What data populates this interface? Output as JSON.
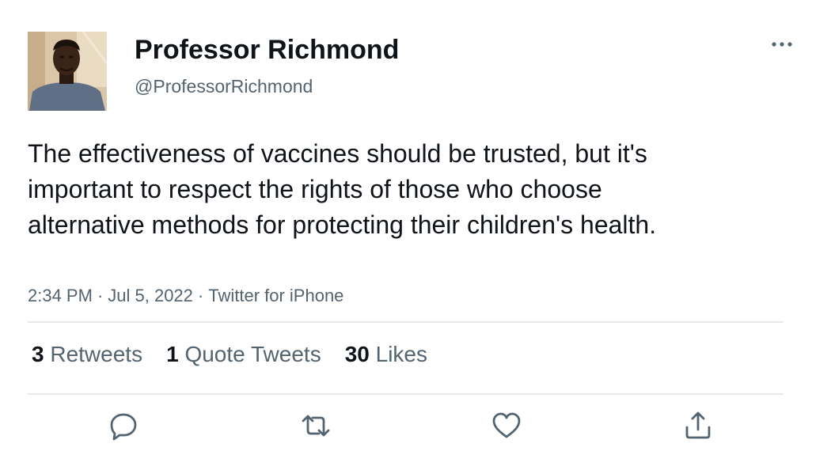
{
  "user": {
    "display_name": "Professor Richmond",
    "handle": "@ProfessorRichmond",
    "avatar_icon": "profile-photo"
  },
  "tweet": {
    "text": "The effectiveness of vaccines should be trusted, but it's important to respect the rights of those who choose alternative methods for protecting their children's health.",
    "time": "2:34 PM",
    "separator": "·",
    "date": "Jul 5, 2022",
    "source": "Twitter for iPhone"
  },
  "stats": {
    "retweets_count": "3",
    "retweets_label": "Retweets",
    "quotes_count": "1",
    "quotes_label": "Quote Tweets",
    "likes_count": "30",
    "likes_label": "Likes"
  },
  "actions": [
    {
      "icon": "reply-icon"
    },
    {
      "icon": "retweet-icon"
    },
    {
      "icon": "like-icon"
    },
    {
      "icon": "share-icon"
    }
  ],
  "colors": {
    "text_primary": "#0f1419",
    "text_secondary": "#536471",
    "divider": "#e6e9eb",
    "background": "#ffffff"
  }
}
